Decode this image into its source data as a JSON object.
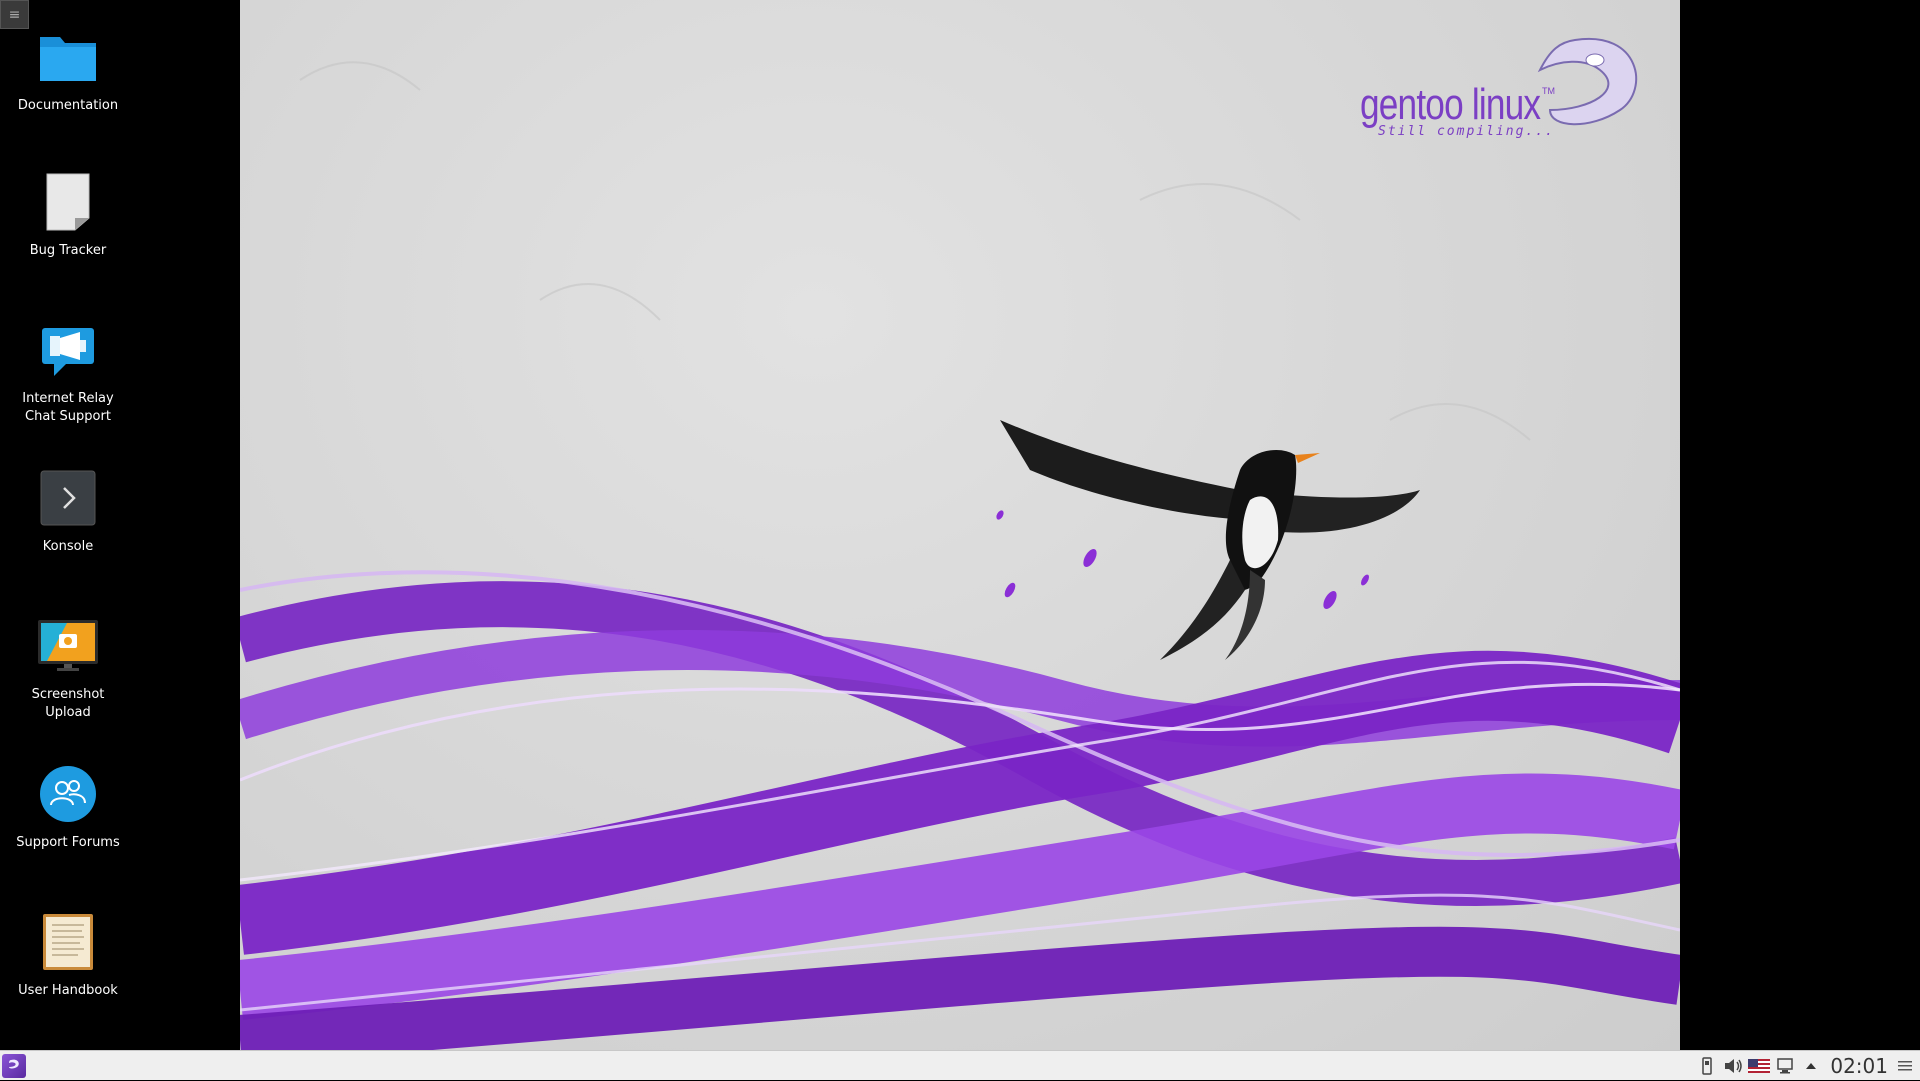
{
  "desktop": {
    "toolbox_glyph": "≡",
    "wallpaper": {
      "logo_text": "gentoo linux",
      "logo_tm": "TM",
      "logo_tagline": "Still compiling...",
      "accent": "#8b2fd6"
    },
    "icons": [
      {
        "label": "Documentation",
        "icon": "folder-icon"
      },
      {
        "label": "Bug Tracker",
        "icon": "document-icon"
      },
      {
        "label": "Internet Relay Chat Support",
        "icon": "irc-chat-icon"
      },
      {
        "label": "Konsole",
        "icon": "terminal-icon"
      },
      {
        "label": "Screenshot Upload",
        "icon": "screenshot-icon"
      },
      {
        "label": "Support Forums",
        "icon": "forums-icon"
      },
      {
        "label": "User Handbook",
        "icon": "handbook-icon"
      }
    ]
  },
  "taskbar": {
    "launcher_icon": "gentoo-launcher-icon",
    "tray": [
      "device-icon",
      "volume-icon",
      "us-flag-keyboard-icon",
      "network-icon",
      "expand-arrow-icon"
    ],
    "clock": "02:01",
    "background": "#efefef"
  }
}
